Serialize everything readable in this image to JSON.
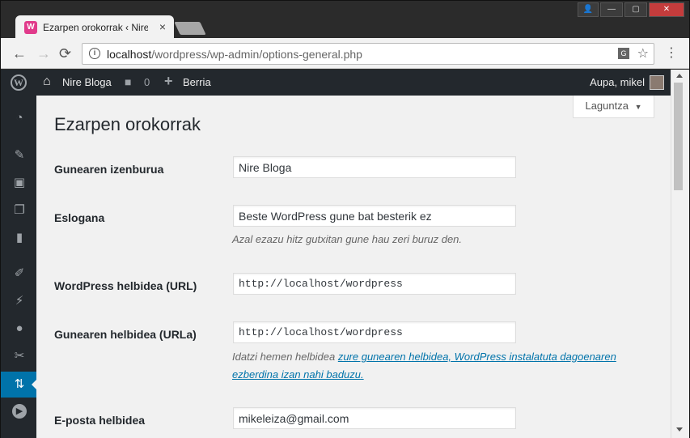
{
  "browser": {
    "tab_title": "Ezarpen orokorrak ‹ Nire",
    "tab_favicon": "W",
    "tab_close": "×",
    "url_host": "localhost",
    "url_path": "/wordpress/wp-admin/options-general.php",
    "back_icon": "←",
    "forward_icon": "→",
    "reload_icon": "⟳",
    "info_icon": "i",
    "translate_icon": "G",
    "star_icon": "☆",
    "menu_icon": "⋮",
    "win_minimize": "—",
    "win_maximize": "▢",
    "win_close": "✕",
    "win_user": "👤"
  },
  "adminbar": {
    "wp_logo": "W",
    "site_name": "Nire Bloga",
    "comments_count": "0",
    "new_label": "Berria",
    "new_icon": "+",
    "greeting": "Aupa, mikel"
  },
  "sidebar": {
    "items": [
      {
        "icon": "dashboard-icon",
        "glyph": "◔"
      },
      {
        "icon": "posts-icon",
        "glyph": "✎"
      },
      {
        "icon": "media-icon",
        "glyph": "▣"
      },
      {
        "icon": "pages-icon",
        "glyph": "❐"
      },
      {
        "icon": "comments-icon",
        "glyph": "▮"
      },
      {
        "icon": "appearance-icon",
        "glyph": "✐"
      },
      {
        "icon": "plugins-icon",
        "glyph": "⚡"
      },
      {
        "icon": "users-icon",
        "glyph": "●"
      },
      {
        "icon": "tools-icon",
        "glyph": "✂"
      },
      {
        "icon": "settings-icon",
        "glyph": "⇅"
      },
      {
        "icon": "collapse-icon",
        "glyph": "▶"
      }
    ]
  },
  "content": {
    "help_tab": "Laguntza",
    "help_arrow": "▼",
    "page_title": "Ezarpen orokorrak",
    "fields": [
      {
        "label": "Gunearen izenburua",
        "value": "Nire Bloga"
      },
      {
        "label": "Eslogana",
        "value": "Beste WordPress gune bat besterik ez",
        "description": "Azal ezazu hitz gutxitan gune hau zeri buruz den."
      },
      {
        "label": "WordPress helbidea (URL)",
        "value": "http://localhost/wordpress"
      },
      {
        "label": "Gunearen helbidea (URLa)",
        "value": "http://localhost/wordpress",
        "description_prefix": "Idatzi hemen helbidea ",
        "description_link_1": "zure gunearen helbidea, WordPress instalatuta dagoenaren",
        "description_link_2": "ezberdina izan nahi baduzu."
      },
      {
        "label": "E-posta helbidea",
        "value": "mikeleiza@gmail.com"
      }
    ]
  }
}
